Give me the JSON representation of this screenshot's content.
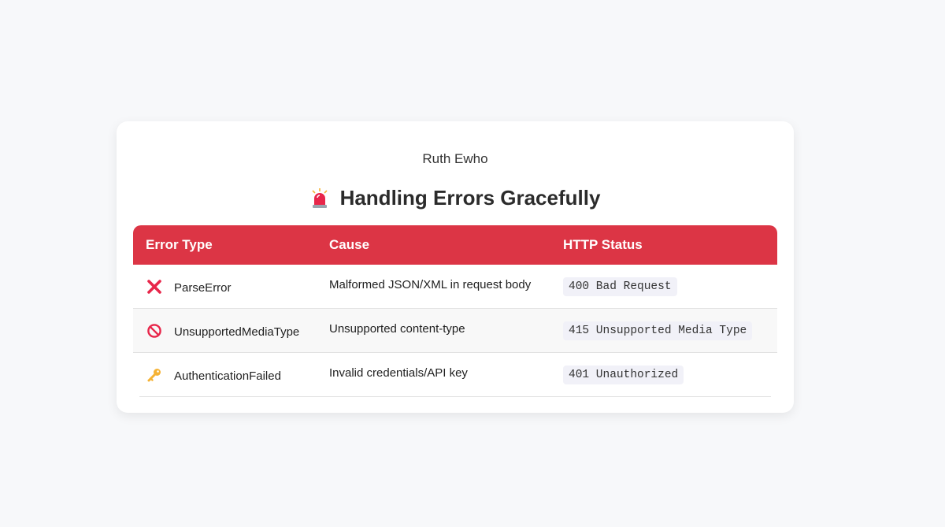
{
  "page": {
    "author": "Ruth Ewho",
    "title": "Handling Errors Gracefully",
    "title_icon": "siren-icon"
  },
  "table": {
    "headers": [
      "Error Type",
      "Cause",
      "HTTP Status"
    ],
    "rows": [
      {
        "icon": "cross-mark-icon",
        "error": "ParseError",
        "cause": "Malformed JSON/XML in request body",
        "status": "400 Bad Request"
      },
      {
        "icon": "no-entry-icon",
        "error": "UnsupportedMediaType",
        "cause": "Unsupported content-type",
        "status": "415 Unsupported Media Type"
      },
      {
        "icon": "key-icon",
        "error": "AuthenticationFailed",
        "cause": "Invalid credentials/API key",
        "status": "401 Unauthorized"
      }
    ]
  },
  "colors": {
    "header_bg": "#dc3545",
    "page_bg": "#f7f8fa",
    "code_bg": "#f1f1f8",
    "cross_red": "#e8264a",
    "key_gold": "#f5b335"
  }
}
